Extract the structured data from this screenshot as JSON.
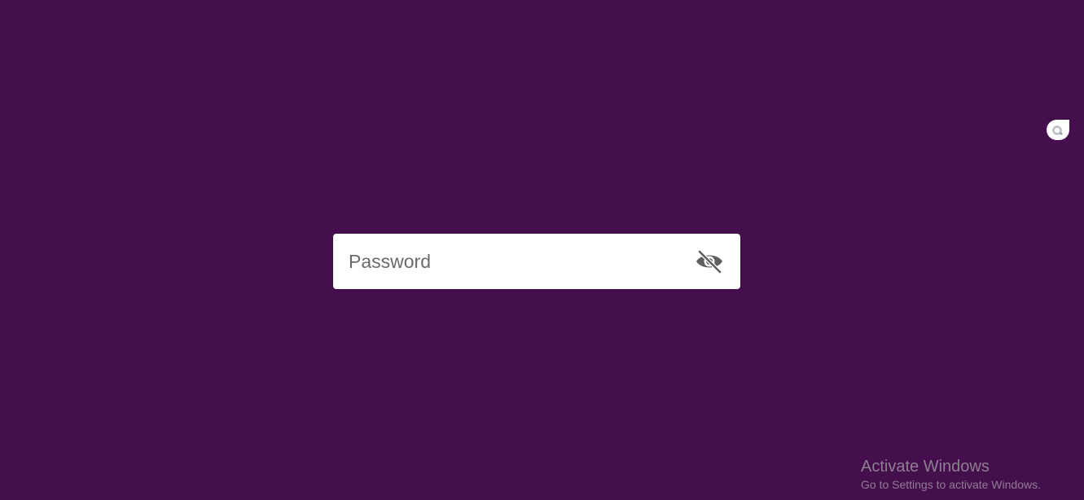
{
  "colors": {
    "background": "#450e4d",
    "field_background": "#ffffff",
    "icon": "#5f5f5f",
    "watermark_text": "#8e7f93"
  },
  "password_field": {
    "placeholder": "Password",
    "value": "",
    "toggle_icon": "eye-off-icon"
  },
  "side_widget": {
    "icon": "circle-dot-icon"
  },
  "watermark": {
    "title": "Activate Windows",
    "subtitle": "Go to Settings to activate Windows."
  }
}
